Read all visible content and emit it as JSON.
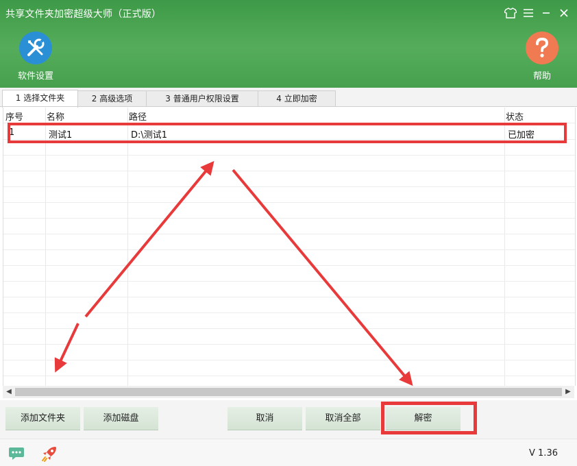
{
  "window": {
    "title": "共享文件夹加密超级大师（正式版）",
    "controls": [
      "skin-icon",
      "menu-icon",
      "minimize-icon",
      "close-icon"
    ]
  },
  "toolbar": {
    "settings_label": "软件设置",
    "help_label": "帮助"
  },
  "tabs": [
    {
      "label": "1 选择文件夹",
      "active": true
    },
    {
      "label": "2 高级选项",
      "active": false
    },
    {
      "label": "3 普通用户权限设置",
      "active": false
    },
    {
      "label": "4 立即加密",
      "active": false
    }
  ],
  "table": {
    "columns": [
      "序号",
      "名称",
      "路径",
      "状态"
    ],
    "rows": [
      {
        "index": "1",
        "name": "测试1",
        "path": "D:\\测试1",
        "status": "已加密"
      }
    ]
  },
  "buttons": {
    "add_folder": "添加文件夹",
    "add_disk": "添加磁盘",
    "cancel": "取消",
    "cancel_all": "取消全部",
    "decrypt": "解密"
  },
  "statusbar": {
    "version": "V 1.36"
  },
  "colors": {
    "header_green": "#4ea656",
    "settings_icon_bg": "#2b8fd6",
    "help_icon_bg": "#f07a52",
    "annotation_red": "#e83a3a",
    "button_green": "#dbe8db"
  }
}
